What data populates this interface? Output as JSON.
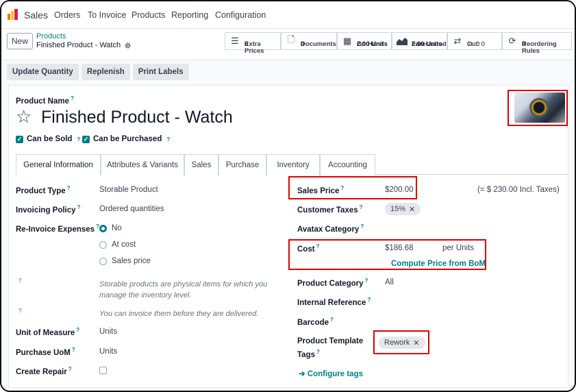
{
  "nav": {
    "app_name": "Sales",
    "items": [
      "Orders",
      "To Invoice",
      "Products",
      "Reporting",
      "Configuration"
    ]
  },
  "control_panel": {
    "new_label": "New",
    "breadcrumb_parent": "Products",
    "breadcrumb_current": "Finished Product - Watch",
    "smart_buttons": [
      {
        "icon": "list-icon",
        "label": "Extra Prices",
        "value": "0"
      },
      {
        "icon": "document-icon",
        "label": "Documents",
        "value": "0"
      },
      {
        "icon": "cubes-icon",
        "label": "On Hand",
        "value": "2.00 Units"
      },
      {
        "icon": "area-chart-icon",
        "label": "Forecasted",
        "value": "2.00 Units"
      },
      {
        "icon": "exchange-icon",
        "label": "In: 0",
        "value": "Out: 0"
      },
      {
        "icon": "refresh-icon",
        "label": "Reordering Rules",
        "value": "0"
      }
    ]
  },
  "actions": [
    "Update Quantity",
    "Replenish",
    "Print Labels"
  ],
  "form": {
    "product_name_label": "Product Name",
    "help_mark": "?",
    "title": "Finished Product - Watch",
    "can_be_sold": "Can be Sold",
    "can_be_purchased": "Can be Purchased",
    "tabs": [
      "General Information",
      "Attributes & Variants",
      "Sales",
      "Purchase",
      "Inventory",
      "Accounting"
    ],
    "left": {
      "product_type_label": "Product Type",
      "product_type": "Storable Product",
      "invoicing_policy_label": "Invoicing Policy",
      "invoicing_policy": "Ordered quantities",
      "reinvoice_label": "Re-Invoice Expenses",
      "reinvoice_options": [
        "No",
        "At cost",
        "Sales price"
      ],
      "hint_storable": "Storable products are physical items for which you manage the inventory level.",
      "hint_invoice": "You can invoice them before they are delivered.",
      "uom_label": "Unit of Measure",
      "uom": "Units",
      "purchase_uom_label": "Purchase UoM",
      "purchase_uom": "Units",
      "create_repair_label": "Create Repair"
    },
    "right": {
      "sales_price_label": "Sales Price",
      "sales_price": "$200.00",
      "incl_taxes": "(= $ 230.00 Incl. Taxes)",
      "customer_taxes_label": "Customer Taxes",
      "customer_tax_tag": "15%",
      "avatax_label": "Avatax Category",
      "cost_label": "Cost",
      "cost": "$186.68",
      "per_units": "per Units",
      "compute_bom": "Compute Price from BoM",
      "category_label": "Product Category",
      "category": "All",
      "internal_ref_label": "Internal Reference",
      "barcode_label": "Barcode",
      "template_tags_label_1": "Product Template",
      "template_tags_label_2": "Tags",
      "template_tag": "Rework",
      "configure_tags": "Configure tags"
    }
  },
  "colors": {
    "accent": "#017e84",
    "highlight_box": "#e00000"
  }
}
